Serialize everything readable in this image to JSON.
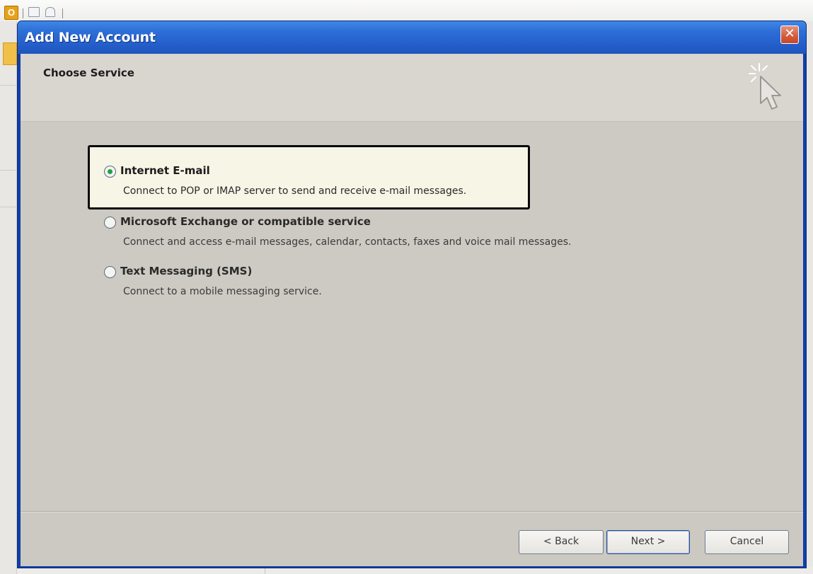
{
  "host": {
    "app_logo_letter": "O"
  },
  "dialog": {
    "title": "Add New Account",
    "close_glyph": "✕",
    "header": {
      "title": "Choose Service",
      "icon": "cursor-sparkle-icon"
    },
    "options": [
      {
        "label": "Internet E-mail",
        "description": "Connect to POP or IMAP server to send and receive e-mail messages.",
        "selected": true
      },
      {
        "label": "Microsoft Exchange or compatible service",
        "description": "Connect and access e-mail messages, calendar, contacts, faxes and voice mail messages.",
        "selected": false
      },
      {
        "label": "Text Messaging (SMS)",
        "description": "Connect to a mobile messaging service.",
        "selected": false
      }
    ],
    "buttons": {
      "back": "< Back",
      "next": "Next >",
      "cancel": "Cancel"
    },
    "colors": {
      "title_bar": "#245fcb",
      "highlight_border": "#0a0a0a",
      "highlight_fill": "#f7f5e6",
      "radio_dot": "#22a045"
    }
  }
}
